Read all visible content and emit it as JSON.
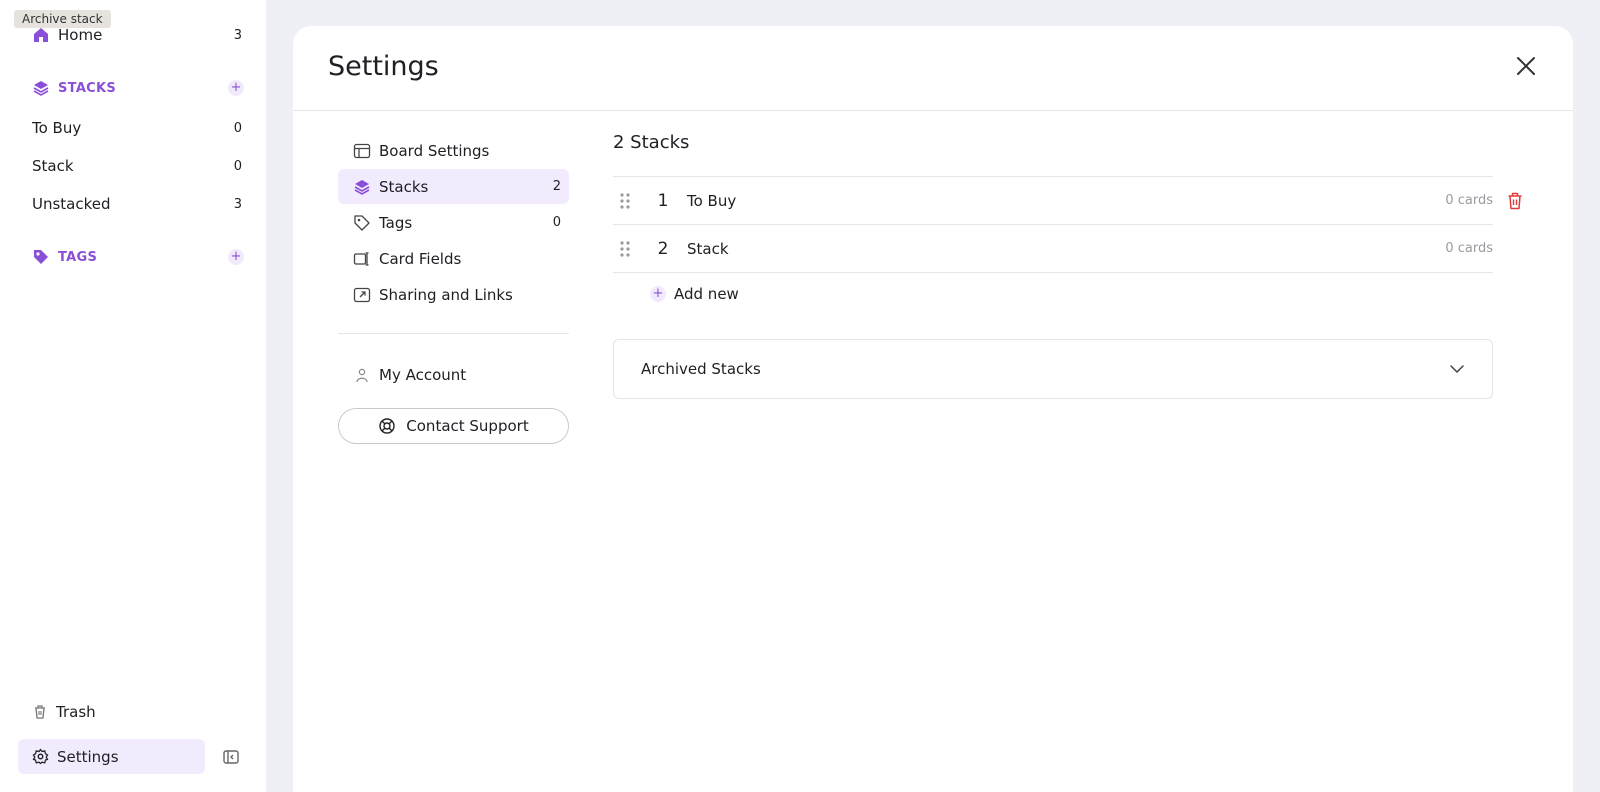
{
  "tooltip": "Archive stack",
  "sidebar": {
    "home": {
      "label": "Home",
      "count": "3"
    },
    "stacks_heading": "STACKS",
    "stacks": [
      {
        "label": "To Buy",
        "count": "0"
      },
      {
        "label": "Stack",
        "count": "0"
      },
      {
        "label": "Unstacked",
        "count": "3"
      }
    ],
    "tags_heading": "TAGS",
    "trash": "Trash",
    "settings": "Settings"
  },
  "modal": {
    "title": "Settings",
    "nav": {
      "board_settings": "Board Settings",
      "stacks": {
        "label": "Stacks",
        "count": "2"
      },
      "tags": {
        "label": "Tags",
        "count": "0"
      },
      "card_fields": "Card Fields",
      "sharing": "Sharing and Links",
      "my_account": "My Account",
      "contact_support": "Contact Support"
    },
    "content": {
      "title": "2 Stacks",
      "stacks": [
        {
          "num": "1",
          "name": "To Buy",
          "cards": "0 cards"
        },
        {
          "num": "2",
          "name": "Stack",
          "cards": "0 cards"
        }
      ],
      "add_new": "Add new",
      "archived": "Archived Stacks"
    }
  },
  "colors": {
    "accent": "#8a4fd8",
    "active_bg": "#f2eafd",
    "danger": "#e03b3b"
  }
}
